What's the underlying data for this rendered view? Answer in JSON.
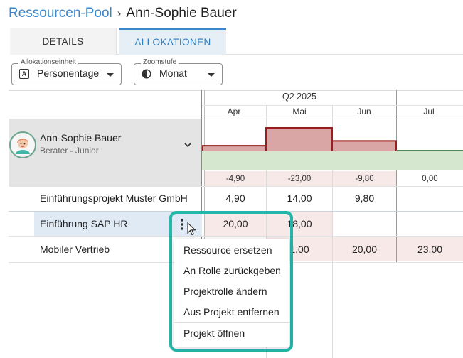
{
  "breadcrumb": {
    "parent": "Ressourcen-Pool",
    "separator": "›",
    "current": "Ann-Sophie Bauer"
  },
  "tabs": [
    {
      "label": "DETAILS",
      "active": false
    },
    {
      "label": "ALLOKATIONEN",
      "active": true
    }
  ],
  "filters": {
    "unit": {
      "label": "Allokationseinheit",
      "value": "Personentage",
      "icon": "calendar-a-icon"
    },
    "zoom": {
      "label": "Zoomstufe",
      "value": "Monat",
      "icon": "half-moon-icon"
    }
  },
  "timeline": {
    "quarter": "Q2 2025",
    "months": [
      "Apr",
      "Mai",
      "Jun",
      "Jul"
    ]
  },
  "resource": {
    "name": "Ann-Sophie Bauer",
    "role": "Berater - Junior",
    "balance": [
      "-4,90",
      "-23,00",
      "-9,80",
      "0,00"
    ],
    "balance_values": [
      -4.9,
      -23.0,
      -9.8,
      0.0
    ]
  },
  "projects": [
    {
      "name": "Einführungsprojekt Muster GmbH",
      "cells": [
        "4,90",
        "14,00",
        "9,80",
        ""
      ]
    },
    {
      "name": "Einführung SAP HR",
      "cells": [
        "20,00",
        "18,00",
        "",
        ""
      ]
    },
    {
      "name": "Mobiler Vertrieb",
      "cells": [
        "",
        "1,00",
        "20,00",
        "23,00"
      ]
    }
  ],
  "context_menu": {
    "items": [
      "Ressource ersetzen",
      "An Rolle zurückgeben",
      "Projektrolle ändern",
      "Aus Projekt entfernen"
    ],
    "footer_item": "Projekt öffnen"
  },
  "colors": {
    "accent": "#3a86c8",
    "over_capacity": "#d9a5a5",
    "over_line": "#9b1c1c",
    "capacity_fill": "#d5e7cf",
    "capacity_line": "#4f8a5b",
    "highlight_ring": "#24b8ab"
  }
}
